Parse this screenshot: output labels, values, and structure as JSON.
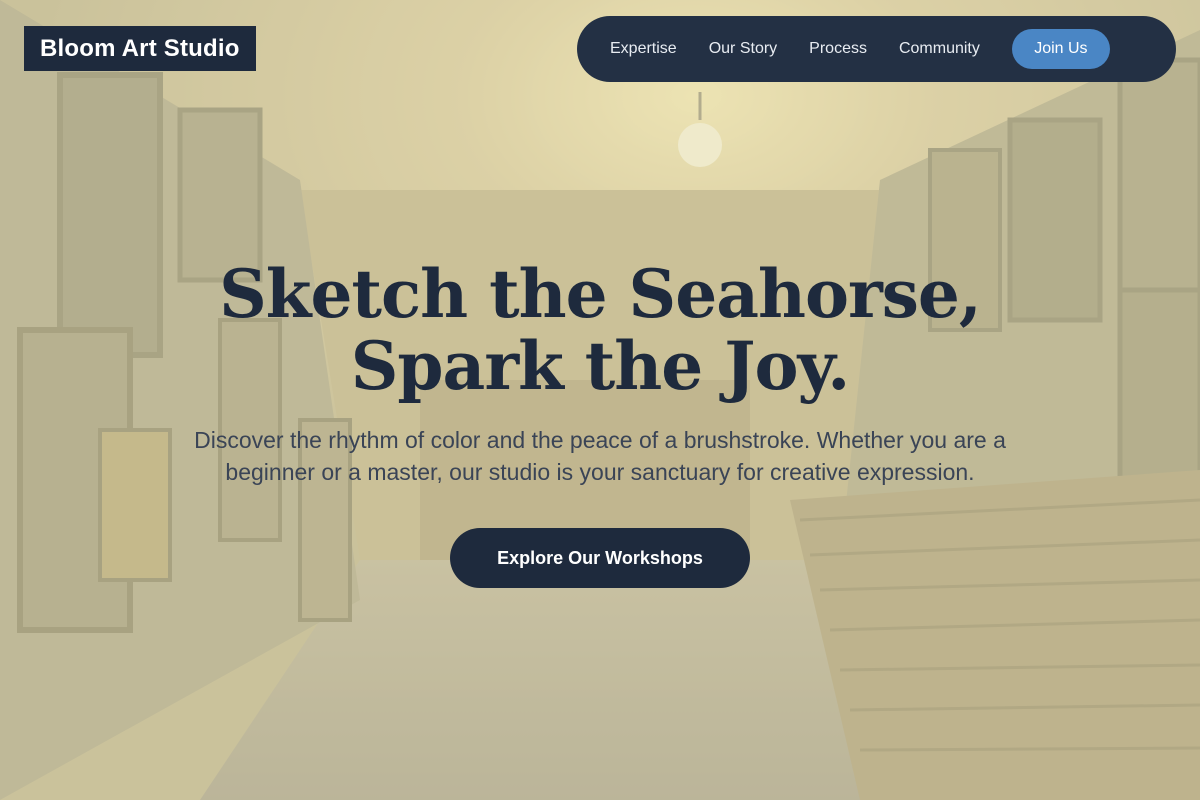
{
  "brand": {
    "name": "Bloom Art Studio"
  },
  "nav": {
    "links": [
      "Expertise",
      "Our Story",
      "Process",
      "Community"
    ],
    "cta_label": "Join Us"
  },
  "hero": {
    "headline_line1": "Sketch the Seahorse,",
    "headline_line2": "Spark the Joy.",
    "subtitle": "Discover the rhythm of color and the peace of a brushstroke. Whether you are a beginner or a master, our studio is your sanctuary for creative expression.",
    "cta_label": "Explore Our Workshops",
    "background_image": "art-studio-gallery-photo"
  },
  "colors": {
    "brand_navy": "#1e2a3d",
    "nav_bg": "#233044",
    "accent_blue": "#4a86c5"
  }
}
